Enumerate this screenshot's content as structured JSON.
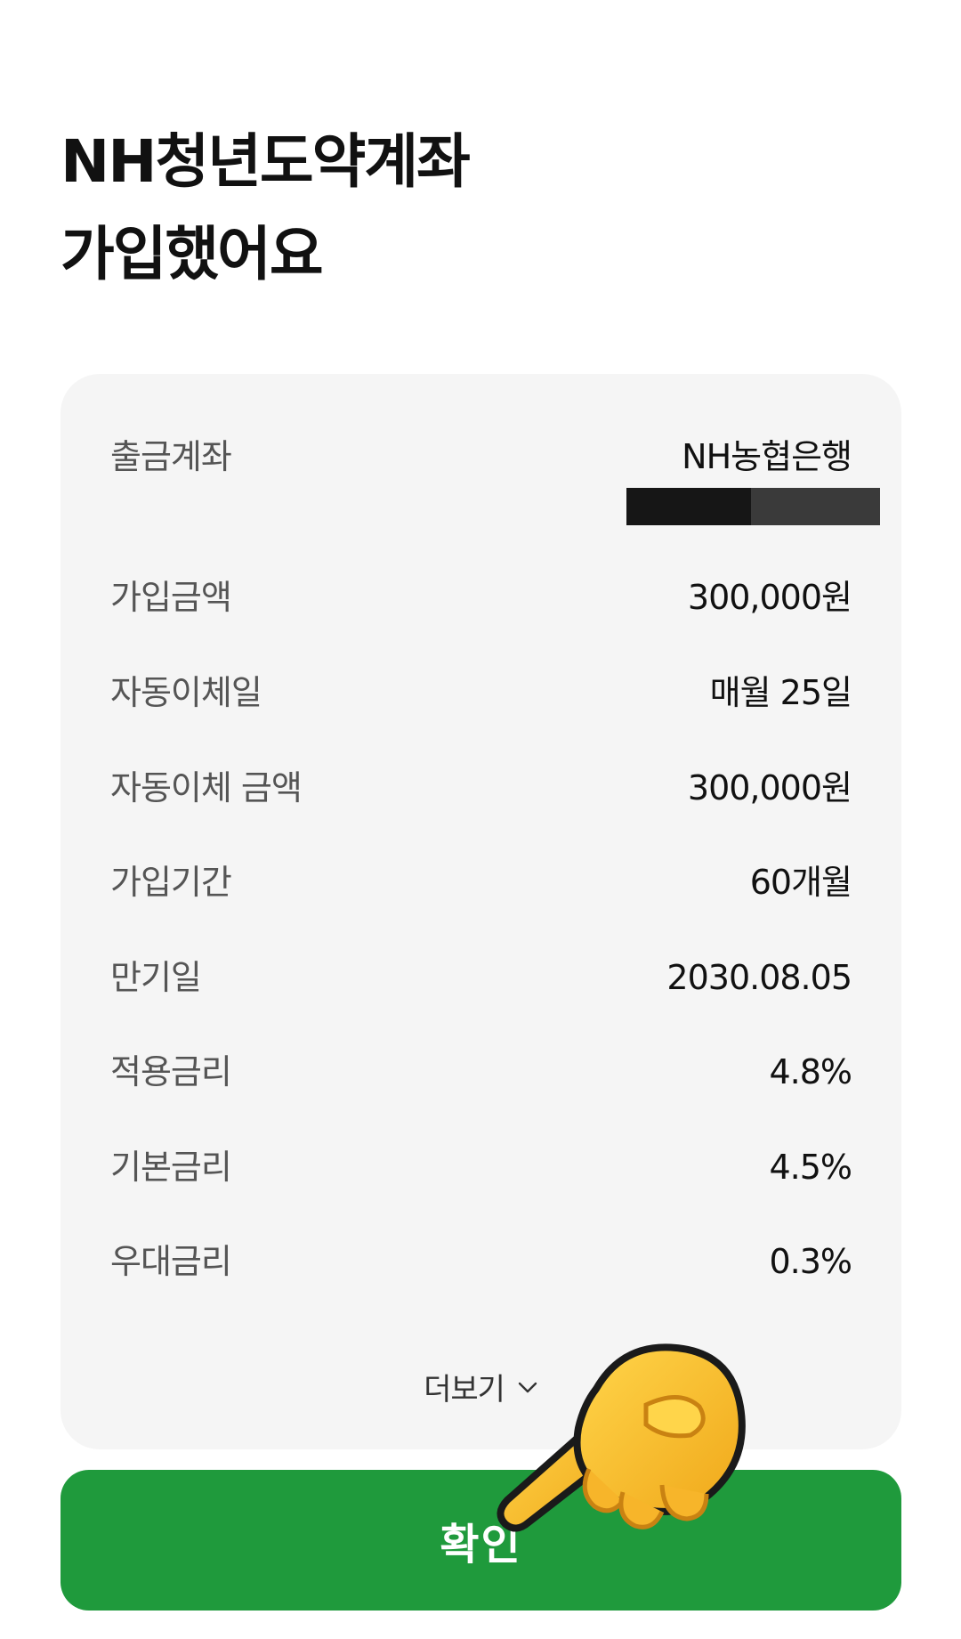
{
  "header": {
    "title_line1": "NH청년도약계좌",
    "title_line2": "가입했어요"
  },
  "details": {
    "rows": [
      {
        "label": "출금계좌",
        "value": "NH농협은행"
      },
      {
        "label": "가입금액",
        "value": "300,000원"
      },
      {
        "label": "자동이체일",
        "value": "매월 25일"
      },
      {
        "label": "자동이체 금액",
        "value": "300,000원"
      },
      {
        "label": "가입기간",
        "value": "60개월"
      },
      {
        "label": "만기일",
        "value": "2030.08.05"
      },
      {
        "label": "적용금리",
        "value": "4.8%"
      },
      {
        "label": "기본금리",
        "value": "4.5%"
      },
      {
        "label": "우대금리",
        "value": "0.3%"
      }
    ],
    "more_label": "더보기",
    "more_icon": "chevron-down-icon"
  },
  "confirm_button": {
    "label": "확인",
    "color": "#1f9a3c"
  },
  "overlay": {
    "icon": "pointing-hand-emoji"
  }
}
